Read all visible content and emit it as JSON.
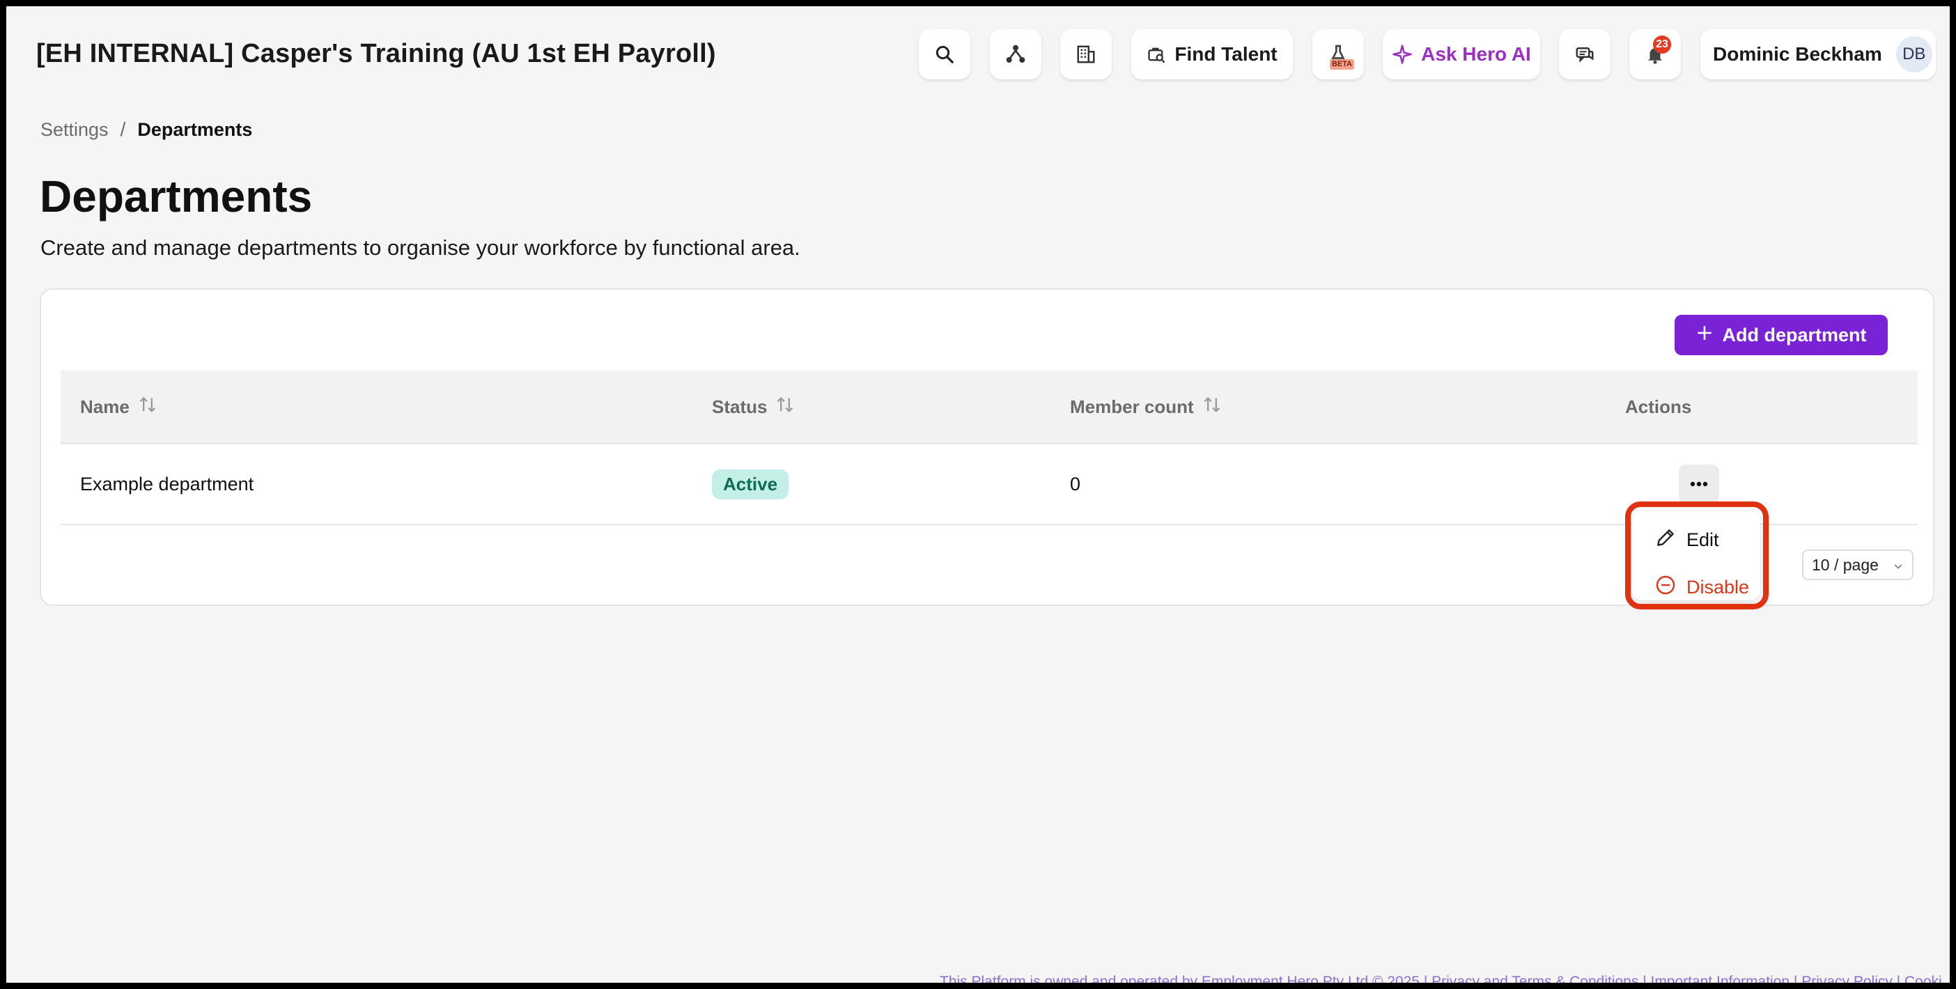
{
  "header": {
    "org_title": "[EH INTERNAL] Casper's Training (AU 1st EH Payroll)",
    "icons": [
      "search-icon",
      "network-icon",
      "building-icon",
      "briefcase-search-icon",
      "flask-icon",
      "sparkle-icon",
      "chat-icon",
      "bell-icon"
    ],
    "find_talent_label": "Find Talent",
    "beta_label": "BETA",
    "ask_ai_label": "Ask Hero AI",
    "notification_count": "23",
    "user_name": "Dominic Beckham",
    "user_initials": "DB"
  },
  "breadcrumb": {
    "parent": "Settings",
    "separator": "/",
    "current": "Departments"
  },
  "page": {
    "title": "Departments",
    "description": "Create and manage departments to organise your workforce by functional area."
  },
  "toolbar": {
    "add_label": "Add department"
  },
  "table": {
    "columns": [
      {
        "label": "Name",
        "sortable": true
      },
      {
        "label": "Status",
        "sortable": true
      },
      {
        "label": "Member count",
        "sortable": true
      },
      {
        "label": "Actions",
        "sortable": false
      }
    ],
    "rows": [
      {
        "name": "Example department",
        "status": "Active",
        "member_count": "0"
      }
    ]
  },
  "pagination": {
    "page_size_label": "10 / page"
  },
  "actions_menu": {
    "edit_label": "Edit",
    "disable_label": "Disable"
  },
  "footer": {
    "text": "This Platform is owned and operated by Employment Hero Pty Ltd © 2025 | Privacy and Terms & Conditions | Important Information | Privacy Policy | Cookie Policy"
  },
  "colors": {
    "accent": "#7a22d6",
    "ai_purple": "#9b2fc2",
    "active_badge_bg": "#c3efe6",
    "active_badge_text": "#0e6b58",
    "danger": "#d9361c",
    "highlight": "#e03212"
  }
}
